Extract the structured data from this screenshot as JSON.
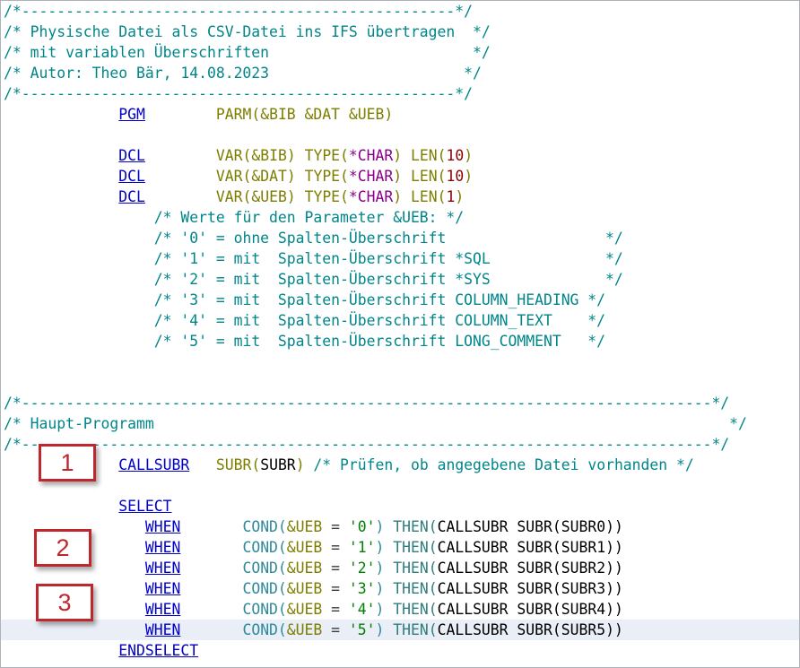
{
  "editor": {
    "current_line_index": 30,
    "lines": [
      [
        {
          "t": "/*-------------------------------------------------*/",
          "c": "cm"
        }
      ],
      [
        {
          "t": "/* Physische Datei als CSV-Datei ins IFS übertragen  */",
          "c": "cm"
        }
      ],
      [
        {
          "t": "/* mit variablen Überschriften                       */",
          "c": "cm"
        }
      ],
      [
        {
          "t": "/* Autor: Theo Bär, 14.08.2023                      */",
          "c": "cm"
        }
      ],
      [
        {
          "t": "/*-------------------------------------------------*/",
          "c": "cm"
        }
      ],
      [
        {
          "t": "             "
        },
        {
          "t": "PGM",
          "c": "kw"
        },
        {
          "t": "        "
        },
        {
          "t": "PARM(",
          "c": "fn"
        },
        {
          "t": "&BIB &DAT &UEB",
          "c": "var"
        },
        {
          "t": ")",
          "c": "fn"
        }
      ],
      [],
      [
        {
          "t": "             "
        },
        {
          "t": "DCL",
          "c": "kw"
        },
        {
          "t": "        "
        },
        {
          "t": "VAR(",
          "c": "fn"
        },
        {
          "t": "&BIB",
          "c": "var"
        },
        {
          "t": ") ",
          "c": "fn"
        },
        {
          "t": "TYPE(",
          "c": "fn"
        },
        {
          "t": "*CHAR",
          "c": "ptype"
        },
        {
          "t": ") ",
          "c": "fn"
        },
        {
          "t": "LEN(",
          "c": "fn"
        },
        {
          "t": "10",
          "c": "num"
        },
        {
          "t": ")",
          "c": "fn"
        }
      ],
      [
        {
          "t": "             "
        },
        {
          "t": "DCL",
          "c": "kw"
        },
        {
          "t": "        "
        },
        {
          "t": "VAR(",
          "c": "fn"
        },
        {
          "t": "&DAT",
          "c": "var"
        },
        {
          "t": ") ",
          "c": "fn"
        },
        {
          "t": "TYPE(",
          "c": "fn"
        },
        {
          "t": "*CHAR",
          "c": "ptype"
        },
        {
          "t": ") ",
          "c": "fn"
        },
        {
          "t": "LEN(",
          "c": "fn"
        },
        {
          "t": "10",
          "c": "num"
        },
        {
          "t": ")",
          "c": "fn"
        }
      ],
      [
        {
          "t": "             "
        },
        {
          "t": "DCL",
          "c": "kw"
        },
        {
          "t": "        "
        },
        {
          "t": "VAR(",
          "c": "fn"
        },
        {
          "t": "&UEB",
          "c": "var"
        },
        {
          "t": ") ",
          "c": "fn"
        },
        {
          "t": "TYPE(",
          "c": "fn"
        },
        {
          "t": "*CHAR",
          "c": "ptype"
        },
        {
          "t": ") ",
          "c": "fn"
        },
        {
          "t": "LEN(",
          "c": "fn"
        },
        {
          "t": "1",
          "c": "num"
        },
        {
          "t": ")",
          "c": "fn"
        }
      ],
      [
        {
          "t": "                 "
        },
        {
          "t": "/* Werte für den Parameter &UEB: */",
          "c": "cm"
        }
      ],
      [
        {
          "t": "                 "
        },
        {
          "t": "/* '0' = ohne Spalten-Überschrift                  */",
          "c": "cm"
        }
      ],
      [
        {
          "t": "                 "
        },
        {
          "t": "/* '1' = mit  Spalten-Überschrift *SQL             */",
          "c": "cm"
        }
      ],
      [
        {
          "t": "                 "
        },
        {
          "t": "/* '2' = mit  Spalten-Überschrift *SYS             */",
          "c": "cm"
        }
      ],
      [
        {
          "t": "                 "
        },
        {
          "t": "/* '3' = mit  Spalten-Überschrift COLUMN_HEADING */",
          "c": "cm"
        }
      ],
      [
        {
          "t": "                 "
        },
        {
          "t": "/* '4' = mit  Spalten-Überschrift COLUMN_TEXT    */",
          "c": "cm"
        }
      ],
      [
        {
          "t": "                 "
        },
        {
          "t": "/* '5' = mit  Spalten-Überschrift LONG_COMMENT   */",
          "c": "cm"
        }
      ],
      [],
      [],
      [
        {
          "t": "/*------------------------------------------------------------------------------*/",
          "c": "cm"
        }
      ],
      [
        {
          "t": "/* Haupt-Programm                                                                 */",
          "c": "cm"
        }
      ],
      [
        {
          "t": "/*------------------------------------------------------------------------------*/",
          "c": "cm"
        }
      ],
      [
        {
          "t": "             "
        },
        {
          "t": "CALLSUBR",
          "c": "kw"
        },
        {
          "t": "   "
        },
        {
          "t": "SUBR(",
          "c": "fn"
        },
        {
          "t": "SUBR",
          "c": "black"
        },
        {
          "t": ")",
          "c": "fn"
        },
        {
          "t": " /* Prüfen, ob angegebene Datei vorhanden */",
          "c": "cm"
        }
      ],
      [],
      [
        {
          "t": "             "
        },
        {
          "t": "SELECT",
          "c": "kw"
        }
      ],
      [
        {
          "t": "                "
        },
        {
          "t": "WHEN",
          "c": "kw"
        },
        {
          "t": "       "
        },
        {
          "t": "COND(",
          "c": "cond"
        },
        {
          "t": "&UEB",
          "c": "var"
        },
        {
          "t": " = ",
          "c": "op"
        },
        {
          "t": "'0'",
          "c": "str"
        },
        {
          "t": ") ",
          "c": "cond"
        },
        {
          "t": "THEN(",
          "c": "then"
        },
        {
          "t": "CALLSUBR SUBR(SUBR0))",
          "c": "black"
        }
      ],
      [
        {
          "t": "                "
        },
        {
          "t": "WHEN",
          "c": "kw"
        },
        {
          "t": "       "
        },
        {
          "t": "COND(",
          "c": "cond"
        },
        {
          "t": "&UEB",
          "c": "var"
        },
        {
          "t": " = ",
          "c": "op"
        },
        {
          "t": "'1'",
          "c": "str"
        },
        {
          "t": ") ",
          "c": "cond"
        },
        {
          "t": "THEN(",
          "c": "then"
        },
        {
          "t": "CALLSUBR SUBR(SUBR1))",
          "c": "black"
        }
      ],
      [
        {
          "t": "                "
        },
        {
          "t": "WHEN",
          "c": "kw"
        },
        {
          "t": "       "
        },
        {
          "t": "COND(",
          "c": "cond"
        },
        {
          "t": "&UEB",
          "c": "var"
        },
        {
          "t": " = ",
          "c": "op"
        },
        {
          "t": "'2'",
          "c": "str"
        },
        {
          "t": ") ",
          "c": "cond"
        },
        {
          "t": "THEN(",
          "c": "then"
        },
        {
          "t": "CALLSUBR SUBR(SUBR2))",
          "c": "black"
        }
      ],
      [
        {
          "t": "                "
        },
        {
          "t": "WHEN",
          "c": "kw"
        },
        {
          "t": "       "
        },
        {
          "t": "COND(",
          "c": "cond"
        },
        {
          "t": "&UEB",
          "c": "var"
        },
        {
          "t": " = ",
          "c": "op"
        },
        {
          "t": "'3'",
          "c": "str"
        },
        {
          "t": ") ",
          "c": "cond"
        },
        {
          "t": "THEN(",
          "c": "then"
        },
        {
          "t": "CALLSUBR SUBR(SUBR3))",
          "c": "black"
        }
      ],
      [
        {
          "t": "                "
        },
        {
          "t": "WHEN",
          "c": "kw"
        },
        {
          "t": "       "
        },
        {
          "t": "COND(",
          "c": "cond"
        },
        {
          "t": "&UEB",
          "c": "var"
        },
        {
          "t": " = ",
          "c": "op"
        },
        {
          "t": "'4'",
          "c": "str"
        },
        {
          "t": ") ",
          "c": "cond"
        },
        {
          "t": "THEN(",
          "c": "then"
        },
        {
          "t": "CALLSUBR SUBR(SUBR4))",
          "c": "black"
        }
      ],
      [
        {
          "t": "                "
        },
        {
          "t": "WHEN",
          "c": "kw"
        },
        {
          "t": "       "
        },
        {
          "t": "COND(",
          "c": "cond"
        },
        {
          "t": "&UEB",
          "c": "var"
        },
        {
          "t": " = ",
          "c": "op"
        },
        {
          "t": "'5'",
          "c": "str"
        },
        {
          "t": ") ",
          "c": "cond"
        },
        {
          "t": "THEN(",
          "c": "then"
        },
        {
          "t": "CALLSUBR SUBR(SUBR5))",
          "c": "black"
        }
      ],
      [
        {
          "t": "             "
        },
        {
          "t": "ENDSELECT",
          "c": "kw"
        }
      ]
    ]
  },
  "callouts": [
    "1",
    "2",
    "3"
  ],
  "colors": {
    "comment": "#00868a",
    "keyword": "#0000c8",
    "builtin": "#7d7d00",
    "variable": "#7d7d00",
    "type_value": "#8b008b",
    "number": "#8b0000",
    "string": "#008000",
    "current_line_bg": "#e9eef7",
    "callout_border": "#c0272d"
  }
}
